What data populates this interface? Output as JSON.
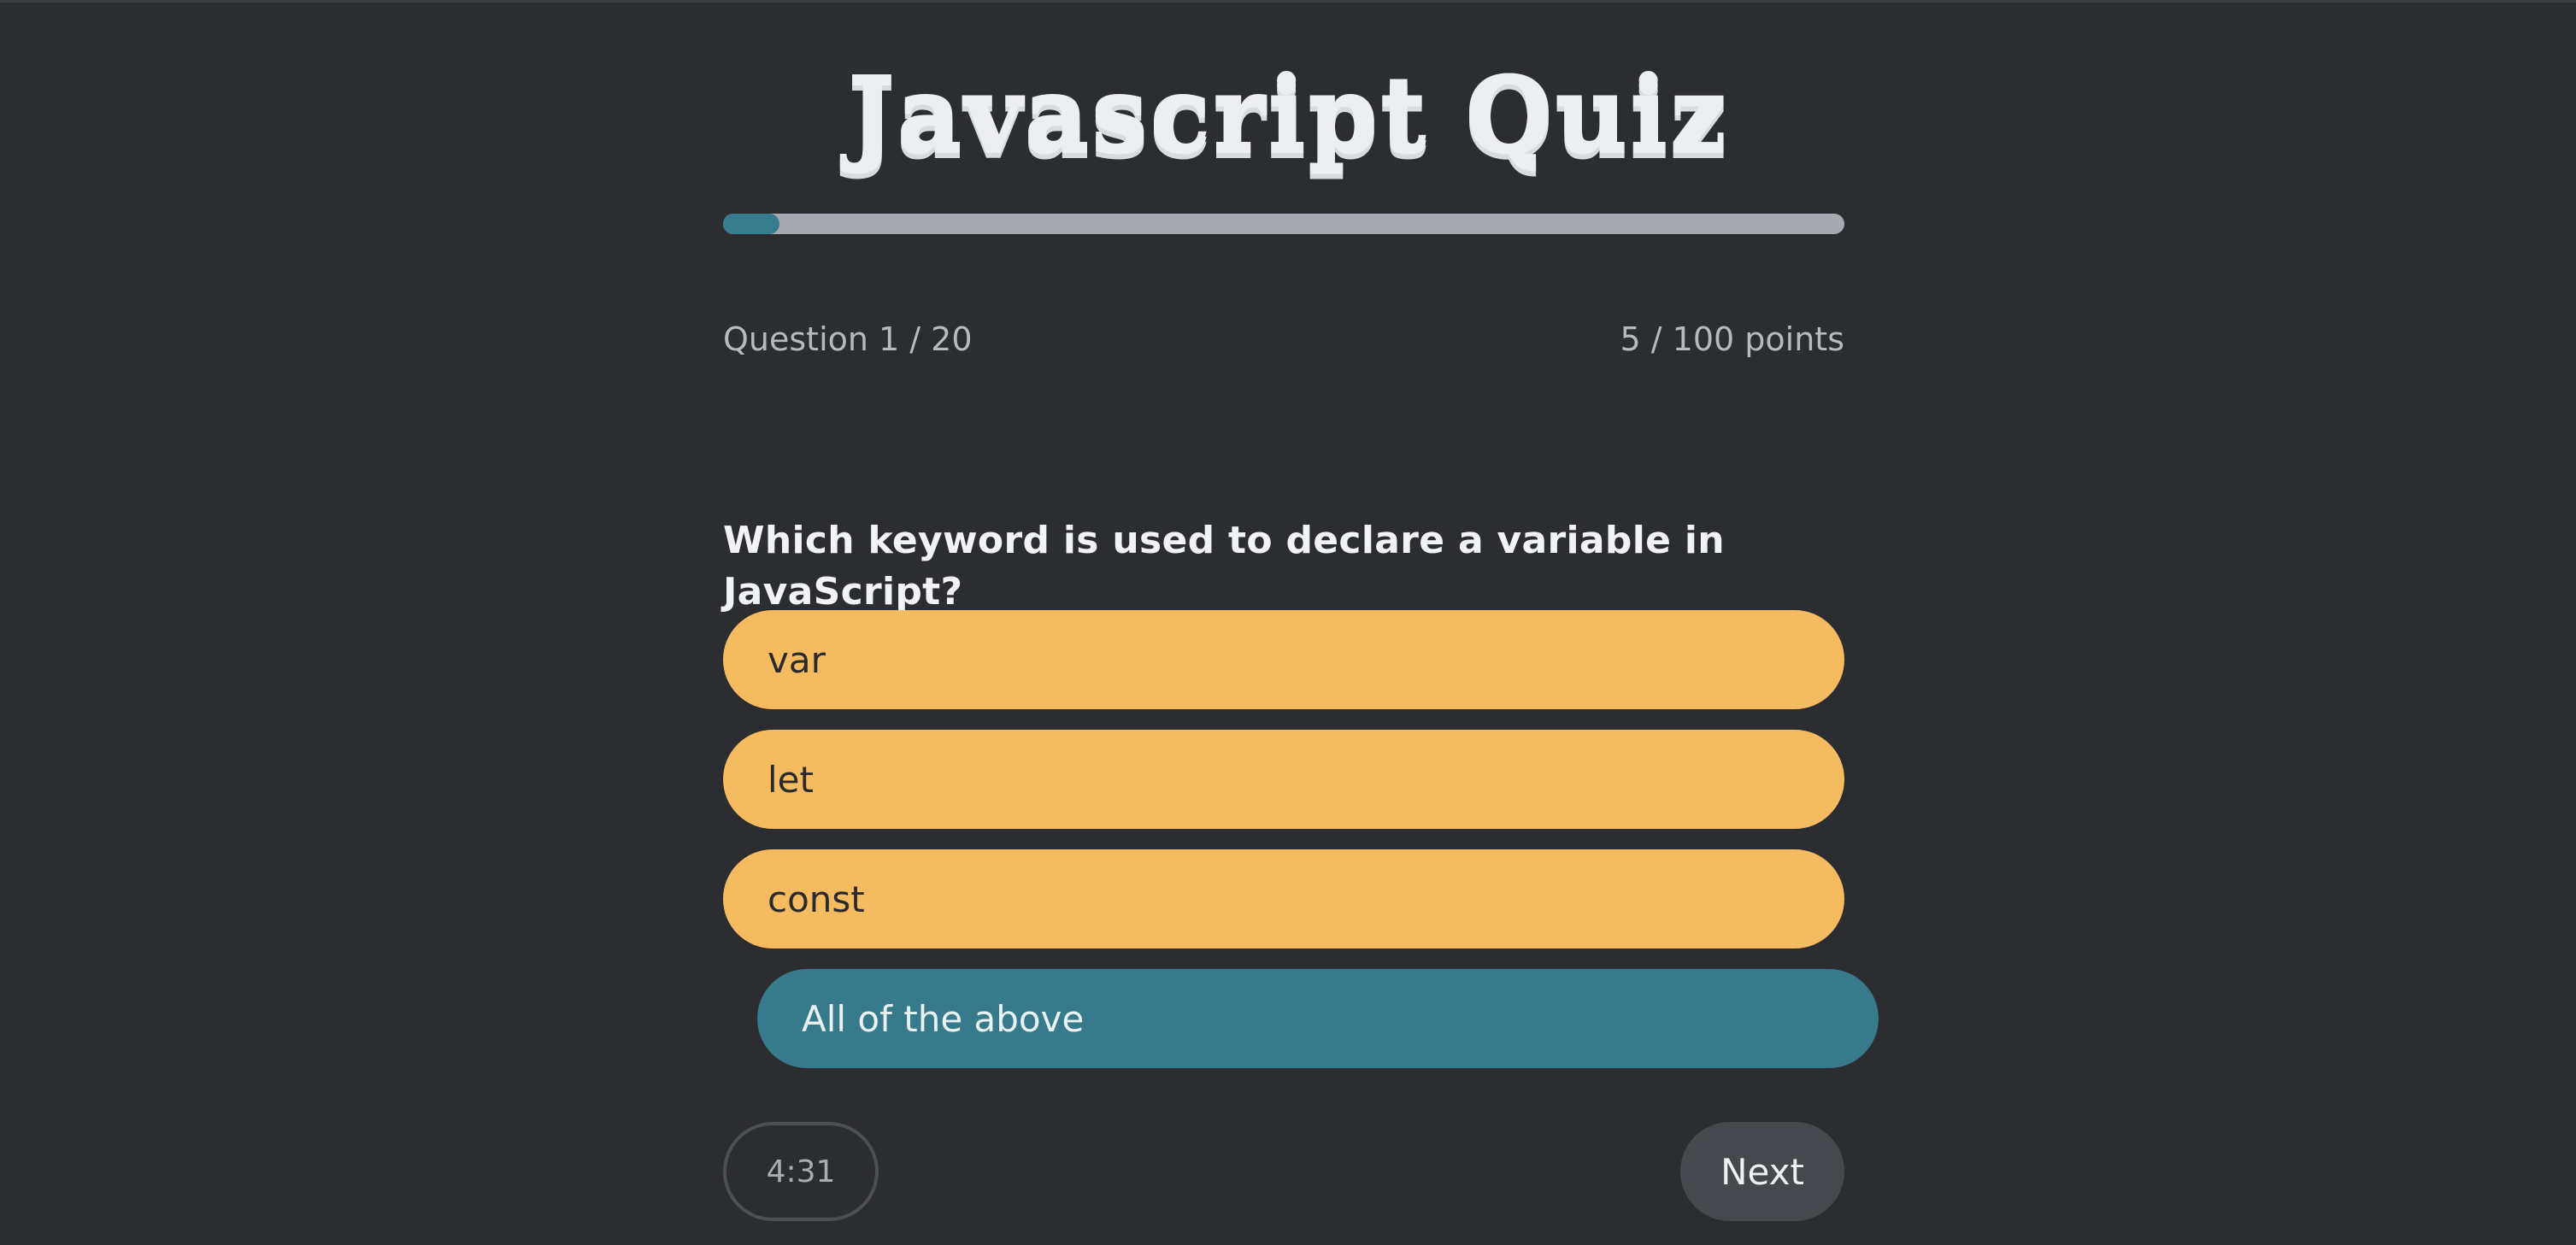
{
  "quiz": {
    "title": "Javascript Quiz",
    "progress_fraction": 0.05,
    "question_counter": "Question 1 / 20",
    "points": "5 / 100 points",
    "question_text": "Which keyword is used to declare a variable in JavaScript?",
    "options": [
      {
        "label": "var",
        "selected": false
      },
      {
        "label": "let",
        "selected": false
      },
      {
        "label": "const",
        "selected": false
      },
      {
        "label": "All of the above",
        "selected": true
      }
    ],
    "timer": "4:31",
    "next_label": "Next"
  },
  "colors": {
    "background": "#2c2d31",
    "option": "#f4bb60",
    "option_selected": "#377a8b",
    "progress_track": "#a6a9af",
    "progress_fill": "#377c8d",
    "next_button": "#45484d"
  }
}
